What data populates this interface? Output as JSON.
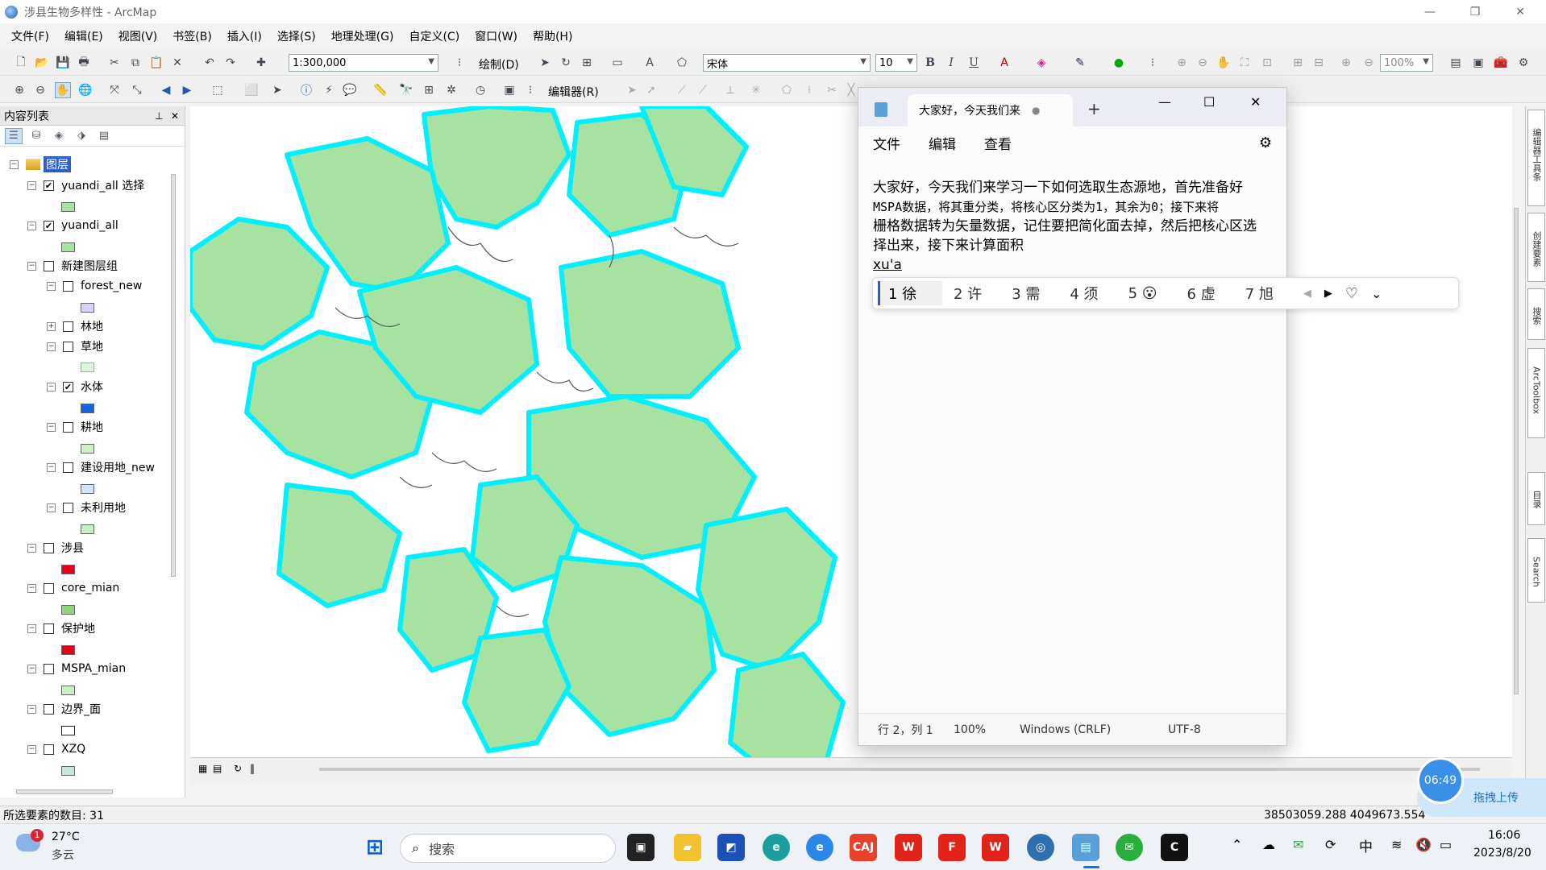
{
  "window": {
    "title": "涉县生物多样性 - ArcMap",
    "min": "—",
    "restore": "❐",
    "close": "✕"
  },
  "menu": [
    "文件(F)",
    "编辑(E)",
    "视图(V)",
    "书签(B)",
    "插入(I)",
    "选择(S)",
    "地理处理(G)",
    "自定义(C)",
    "窗口(W)",
    "帮助(H)"
  ],
  "toolbar": {
    "scale": "1:300,000",
    "draw_label": "绘制(D)",
    "font_name": "宋体",
    "font_size": "10",
    "bold": "B",
    "italic": "I",
    "underline": "U",
    "zoom_percent": "100%",
    "editor_label": "编辑器(R)"
  },
  "toc": {
    "title": "内容列表",
    "pin": "⊥",
    "close": "✕",
    "root_label": "图层",
    "layers": [
      {
        "name": "yuandi_all 选择",
        "checked": true,
        "color": "#a8e2a0"
      },
      {
        "name": "yuandi_all",
        "checked": true,
        "color": "#a8e2a0"
      },
      {
        "name": "新建图层组",
        "checked": false
      },
      {
        "name": "forest_new",
        "checked": false,
        "color": "#d4d4f5"
      },
      {
        "name": "林地",
        "checked": false
      },
      {
        "name": "草地",
        "checked": false
      },
      {
        "name": "水体",
        "checked": true,
        "color": "#1463e0"
      },
      {
        "name": "耕地",
        "checked": false,
        "color": "#d2f0c8"
      },
      {
        "name": "建设用地_new",
        "checked": false,
        "color": "#d4e4f8"
      },
      {
        "name": "未利用地",
        "checked": false,
        "color": "#c4f0c8"
      },
      {
        "name": "涉县",
        "checked": false,
        "color": "#e8001a"
      },
      {
        "name": "core_mian",
        "checked": false,
        "color": "#8fd47a"
      },
      {
        "name": "保护地",
        "checked": false,
        "color": "#e8001a"
      },
      {
        "name": "MSPA_mian",
        "checked": false,
        "color": "#c8f0c0"
      },
      {
        "name": "边界_面",
        "checked": false,
        "color": "#ffffff"
      },
      {
        "name": "XZQ",
        "checked": false,
        "color": "#c4e8d8"
      }
    ]
  },
  "status": {
    "selected": "所选要素的数目: 31",
    "coords": "38503059.288  4049673.554"
  },
  "right_panel": [
    "编辑器工具条",
    "创建要素",
    "搜索",
    "ArcToolbox",
    "目录",
    "Search"
  ],
  "notepad": {
    "tab_title": "大家好，今天我们来",
    "tab_modified": "●",
    "menu": [
      "文件",
      "编辑",
      "查看"
    ],
    "lines": [
      "大家好，今天我们来学习一下如何选取生态源地，首先准备好",
      "MSPA数据，将其重分类，将核心区分类为1，其余为0；接下来将",
      "栅格数据转为矢量数据，记住要把简化面去掉，然后把核心区选",
      "择出来，接下来计算面积",
      "xu'a"
    ],
    "status": {
      "pos": "行 2，列 1",
      "zoom": "100%",
      "eol": "Windows (CRLF)",
      "enc": "UTF-8"
    }
  },
  "ime": {
    "candidates": [
      "1 徐",
      "2 许",
      "3 需",
      "4 须",
      "5 😮",
      "6 虚",
      "7 旭"
    ]
  },
  "recorder": {
    "time": "06:49",
    "upload": "拖拽上传"
  },
  "taskbar": {
    "weather_temp": "27°C",
    "weather_desc": "多云",
    "weather_badge": "1",
    "search": "搜索",
    "time": "16:06",
    "date": "2023/8/20",
    "ime_lang": "中"
  }
}
